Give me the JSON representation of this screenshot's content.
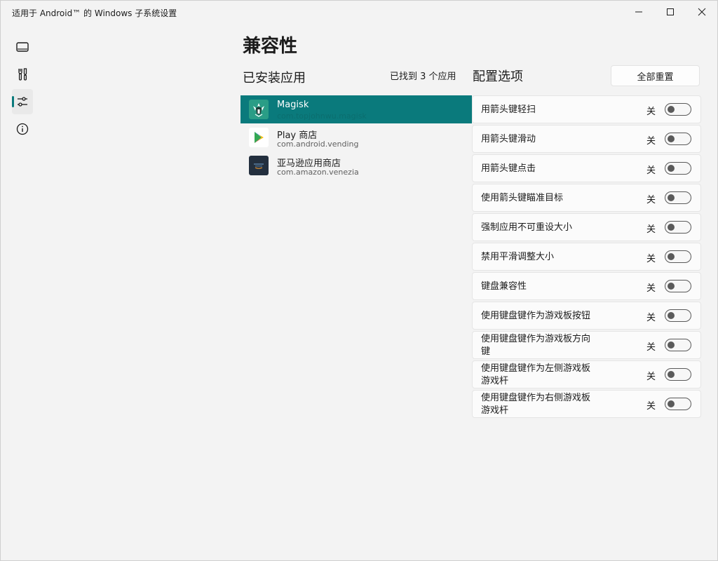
{
  "window": {
    "title": "适用于 Android™ 的 Windows 子系统设置"
  },
  "nav": [
    {
      "icon": "display-icon",
      "active": false
    },
    {
      "icon": "tools-icon",
      "active": false
    },
    {
      "icon": "sliders-icon",
      "active": true
    },
    {
      "icon": "info-icon",
      "active": false
    }
  ],
  "page": {
    "title": "兼容性",
    "installed_heading": "已安装应用",
    "found_count": "已找到 3 个应用",
    "config_heading": "配置选项",
    "reset_label": "全部重置"
  },
  "apps": [
    {
      "name": "Magisk",
      "package": "com.topjohnwu.magisk",
      "icon": "magisk-icon",
      "selected": true
    },
    {
      "name": "Play 商店",
      "package": "com.android.vending",
      "icon": "play-store-icon",
      "selected": false
    },
    {
      "name": "亚马逊应用商店",
      "package": "com.amazon.venezia",
      "icon": "amazon-appstore-icon",
      "selected": false
    }
  ],
  "options": [
    {
      "label": "用箭头键轻扫",
      "state": "关",
      "on": false
    },
    {
      "label": "用箭头键滑动",
      "state": "关",
      "on": false
    },
    {
      "label": "用箭头键点击",
      "state": "关",
      "on": false
    },
    {
      "label": "使用箭头键瞄准目标",
      "state": "关",
      "on": false
    },
    {
      "label": "强制应用不可重设大小",
      "state": "关",
      "on": false
    },
    {
      "label": "禁用平滑调整大小",
      "state": "关",
      "on": false
    },
    {
      "label": "键盘兼容性",
      "state": "关",
      "on": false
    },
    {
      "label": "使用键盘键作为游戏板按钮",
      "state": "关",
      "on": false
    },
    {
      "label": "使用键盘键作为游戏板方向键",
      "state": "关",
      "on": false
    },
    {
      "label": "使用键盘键作为左侧游戏板游戏杆",
      "state": "关",
      "on": false
    },
    {
      "label": "使用键盘键作为右侧游戏板游戏杆",
      "state": "关",
      "on": false
    }
  ]
}
